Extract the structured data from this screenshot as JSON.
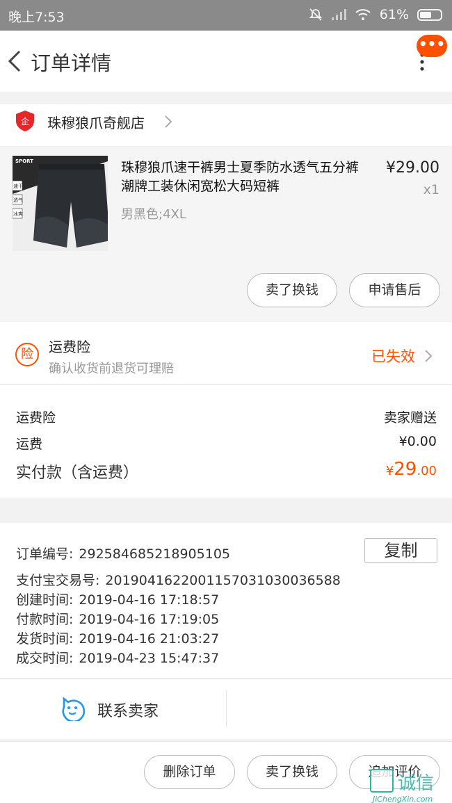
{
  "status_bar": {
    "time": "晚上7:53",
    "battery": "61%"
  },
  "header": {
    "title": "订单详情",
    "more_badge": "•••"
  },
  "shop": {
    "name": "珠穆狼爪奇舰店",
    "badge_text": "企"
  },
  "product": {
    "title": "珠穆狼爪速干裤男士夏季防水透气五分裤潮牌工装休闲宽松大码短裤",
    "sku": "男黑色;4XL",
    "price": "¥29.00",
    "qty": "x1",
    "image_labels": {
      "brand": "SPORT",
      "tag1": "速干",
      "tag2": "透气",
      "tag3": "冰爽"
    },
    "buttons": {
      "sell": "卖了换钱",
      "after_sale": "申请售后"
    }
  },
  "insurance": {
    "icon": "险",
    "title": "运费险",
    "subtitle": "确认收货前退货可理赔",
    "status": "已失效"
  },
  "fees": {
    "insurance_label": "运费险",
    "insurance_value": "卖家赠送",
    "shipping_label": "运费",
    "shipping_value": "¥0.00",
    "paid_label": "实付款（含运费）",
    "paid_currency": "¥",
    "paid_main": "29",
    "paid_decimal": ".00"
  },
  "order_info": {
    "copy_label": "复制",
    "rows": [
      {
        "label": "订单编号:",
        "value": "292584685218905105"
      },
      {
        "label": "支付宝交易号:",
        "value": "2019041622001157031030036588"
      },
      {
        "label": "创建时间:",
        "value": "2019-04-16 17:18:57"
      },
      {
        "label": "付款时间:",
        "value": "2019-04-16 17:19:05"
      },
      {
        "label": "发货时间:",
        "value": "2019-04-16 21:03:27"
      },
      {
        "label": "成交时间:",
        "value": "2019-04-23 15:47:37"
      }
    ]
  },
  "contact": {
    "label": "联系卖家"
  },
  "bottom_bar": {
    "delete": "删除订单",
    "sell": "卖了换钱",
    "review": "追加评价"
  },
  "watermark": {
    "text": "诚信",
    "url": "JiChengXin.com"
  },
  "colors": {
    "accent": "#ff5000",
    "contact_icon": "#2196f3",
    "status_bar": "#8a8a8a"
  }
}
